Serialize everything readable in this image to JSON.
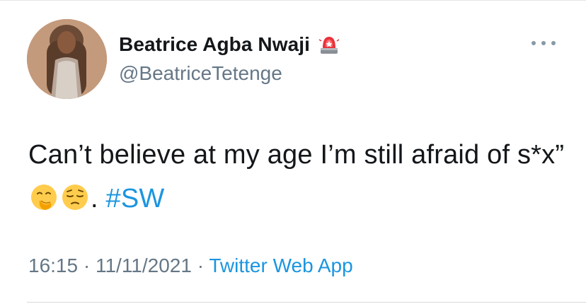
{
  "user": {
    "display_name": "Beatrice Agba Nwaji",
    "handle": "@BeatriceTetenge",
    "badge_icon": "police-siren-icon",
    "avatar_icon": "profile-photo"
  },
  "tweet": {
    "text_part1": "Can’t believe at my age I’m still afraid of s*x”",
    "emoji1": "face-with-hand-over-mouth-icon",
    "emoji2": "pensive-face-icon",
    "text_part2": ". ",
    "hashtag": "#SW"
  },
  "meta": {
    "time": "16:15",
    "sep1": " · ",
    "date": "11/11/2021",
    "sep2": " · ",
    "source": "Twitter Web App"
  },
  "more_icon": "more-options-icon",
  "colors": {
    "link": "#1b95e0",
    "text": "#14171a",
    "secondary": "#657786"
  }
}
